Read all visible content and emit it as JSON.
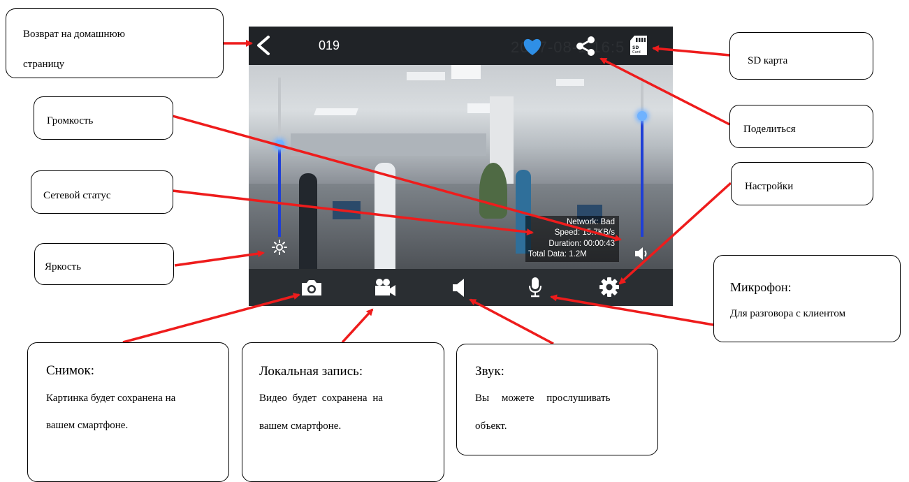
{
  "screen": {
    "camera_id": "019",
    "datestamp": "2017-08-1  16:5",
    "network_info": {
      "network": "Network: Bad",
      "speed": "Speed: 15.7KB/s",
      "duration": "Duration: 00:00:43",
      "total_data": "Total Data: 1.2M"
    },
    "brightness_level": 0.58,
    "volume_level": 0.76
  },
  "callouts": {
    "home": "Возврат на домашнюю страницу",
    "home_line1": "Возврат на домашнюю",
    "home_line2": "страницу",
    "volume": "Громкость",
    "network_status": "Сетевой статус",
    "brightness": "Яркость",
    "sd_card": "SD карта",
    "share": "Поделиться",
    "settings": "Настройки",
    "microphone_title": "Микрофон:",
    "microphone_desc": "Для разговора с клиентом",
    "snapshot_title": "Снимок:",
    "snapshot_line1": "Картинка будет сохранена на",
    "snapshot_line2": "вашем смартфоне.",
    "record_title": "Локальная запись:",
    "record_line1": "Видео будет сохранена на",
    "record_line2": "вашем смартфоне.",
    "sound_title": "Звук:",
    "sound_line1": "Вы можете прослушивать",
    "sound_line2": "объект."
  },
  "icons": {
    "back": "chevron-left-icon",
    "favorite": "heart-icon",
    "share": "share-icon",
    "sd_card": "sd-card-icon",
    "brightness": "sun-icon",
    "volume": "speaker-icon",
    "snapshot": "camera-icon",
    "record": "video-camera-icon",
    "sound": "speaker-icon",
    "microphone": "microphone-icon",
    "settings": "gear-icon"
  },
  "colors": {
    "arrow": "#ee1c1c",
    "favorite": "#2f8fe6",
    "slider_fill": "#1f3fd6"
  }
}
